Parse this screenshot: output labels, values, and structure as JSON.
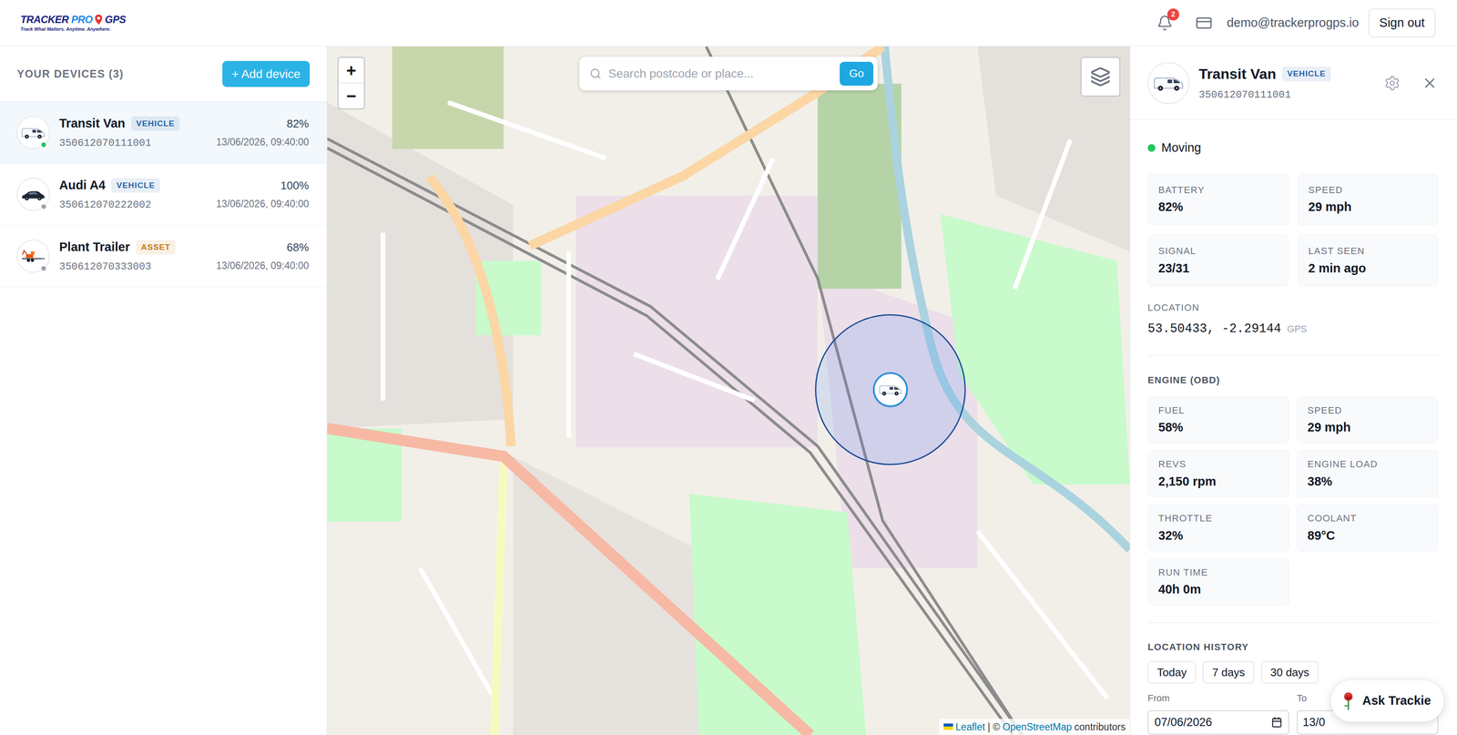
{
  "header": {
    "logo": {
      "parts": [
        {
          "text": "TRACKER",
          "color": "#1a237e"
        },
        {
          "text": "PRO",
          "color": "#1e88e5"
        },
        {
          "text": "GPS",
          "color": "#1a237e"
        }
      ],
      "tagline": "Track What Matters. Anytime. Anywhere."
    },
    "notifications": {
      "count": "2"
    },
    "user": {
      "email": "demo@trackerprogps.io"
    },
    "sign_out": "Sign out"
  },
  "sidebar": {
    "title": "YOUR DEVICES (3)",
    "add_button": "+ Add device",
    "devices": [
      {
        "name": "Transit Van",
        "type": "VEHICLE",
        "color": "#2563a8",
        "imei": "350612070111001",
        "battery": "82%",
        "last_update": "13/06/2026, 09:40:00",
        "online": true,
        "selected": true,
        "kind": "van"
      },
      {
        "name": "Audi A4",
        "type": "VEHICLE",
        "color": "#2563a8",
        "imei": "350612070222002",
        "battery": "100%",
        "last_update": "13/06/2026, 09:40:00",
        "online": false,
        "selected": false,
        "kind": "car"
      },
      {
        "name": "Plant Trailer",
        "type": "ASSET",
        "color": "#c2770e",
        "imei": "350612070333003",
        "battery": "68%",
        "last_update": "13/06/2026, 09:40:00",
        "online": false,
        "selected": false,
        "kind": "trailer"
      }
    ]
  },
  "map": {
    "zoom_in": "+",
    "zoom_out": "−",
    "search": {
      "placeholder": "Search postcode or place...",
      "button": "Go"
    },
    "attribution": {
      "leaflet": "Leaflet",
      "separator": "| ©",
      "osm": "OpenStreetMap",
      "suffix": "contributors"
    }
  },
  "details": {
    "name": "Transit Van",
    "type": "VEHICLE",
    "color": "#2563a8",
    "imei": "350612070111001",
    "kind": "van",
    "status": {
      "label": "Moving",
      "color": "#22c55e"
    },
    "stats": [
      {
        "label": "BATTERY",
        "value": "82%"
      },
      {
        "label": "SPEED",
        "value": "29 mph"
      },
      {
        "label": "SIGNAL",
        "value": "23/31"
      },
      {
        "label": "LAST SEEN",
        "value": "2 min ago"
      }
    ],
    "location": {
      "label": "LOCATION",
      "coords": "53.50433, -2.29144",
      "source": "GPS"
    },
    "engine": {
      "title": "ENGINE (OBD)",
      "stats": [
        {
          "label": "FUEL",
          "value": "58%"
        },
        {
          "label": "SPEED",
          "value": "29 mph"
        },
        {
          "label": "REVS",
          "value": "2,150 rpm"
        },
        {
          "label": "ENGINE LOAD",
          "value": "38%"
        },
        {
          "label": "THROTTLE",
          "value": "32%"
        },
        {
          "label": "COOLANT",
          "value": "89°C"
        },
        {
          "label": "RUN TIME",
          "value": "40h 0m"
        }
      ]
    },
    "history": {
      "title": "LOCATION HISTORY",
      "ranges": [
        {
          "label": "Today",
          "selected": false
        },
        {
          "label": "7 days",
          "selected": false
        },
        {
          "label": "30 days",
          "selected": false
        }
      ],
      "from": {
        "label": "From",
        "value": "07/06/2026"
      },
      "to": {
        "label": "To",
        "value": "13/0"
      }
    }
  },
  "assistant": {
    "label": "Ask Trackie"
  }
}
